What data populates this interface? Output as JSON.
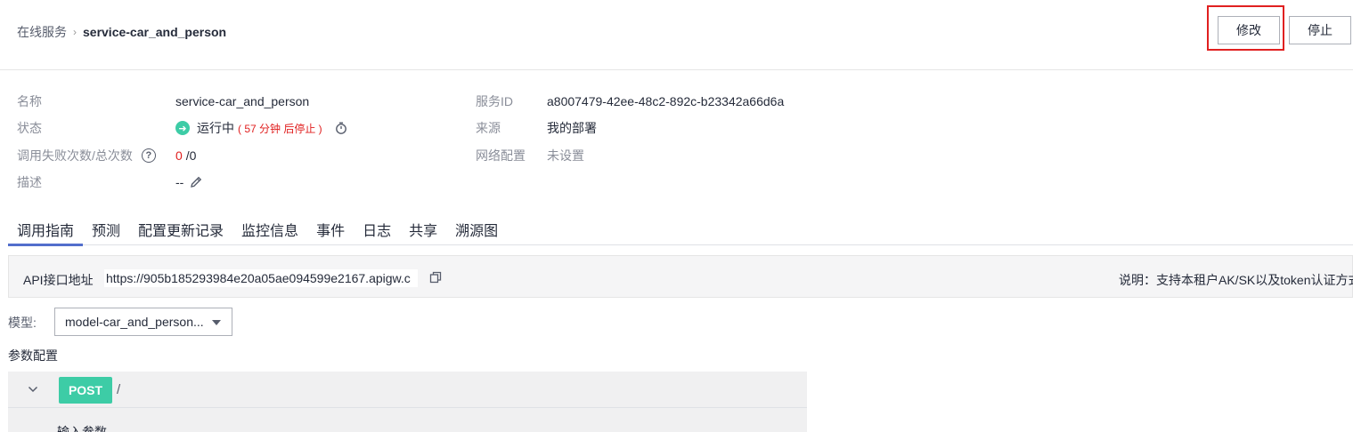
{
  "breadcrumb": {
    "parent": "在线服务",
    "separator": "›",
    "current": "service-car_and_person"
  },
  "actions": {
    "edit_label": "修改",
    "stop_label": "停止"
  },
  "info": {
    "name_label": "名称",
    "name_value": "service-car_and_person",
    "status_label": "状态",
    "status_value": "运行中",
    "status_note": "( 57 分钟 后停止 )",
    "calls_label": "调用失败次数/总次数",
    "fail_count": "0",
    "total_count": "/0",
    "desc_label": "描述",
    "desc_value": "--",
    "service_id_label": "服务ID",
    "service_id_value": "a8007479-42ee-48c2-892c-b23342a66d6a",
    "source_label": "来源",
    "source_value": "我的部署",
    "network_label": "网络配置",
    "network_value": "未设置"
  },
  "tabs": [
    {
      "label": "调用指南",
      "active": true
    },
    {
      "label": "预测",
      "active": false
    },
    {
      "label": "配置更新记录",
      "active": false
    },
    {
      "label": "监控信息",
      "active": false
    },
    {
      "label": "事件",
      "active": false
    },
    {
      "label": "日志",
      "active": false
    },
    {
      "label": "共享",
      "active": false
    },
    {
      "label": "溯源图",
      "active": false
    }
  ],
  "api": {
    "label": "API接口地址",
    "url": "https://905b185293984e20a05ae094599e2167.apigw.c",
    "note": "说明：支持本租户AK/SK以及token认证方式"
  },
  "model": {
    "label": "模型:",
    "selected": "model-car_and_person..."
  },
  "params": {
    "title": "参数配置",
    "method": "POST",
    "path": "/",
    "input_label": "输入参数"
  },
  "colors": {
    "accent": "#526ecc",
    "running": "#3dcca6",
    "danger": "#e02020",
    "highlight": "#e02020"
  }
}
